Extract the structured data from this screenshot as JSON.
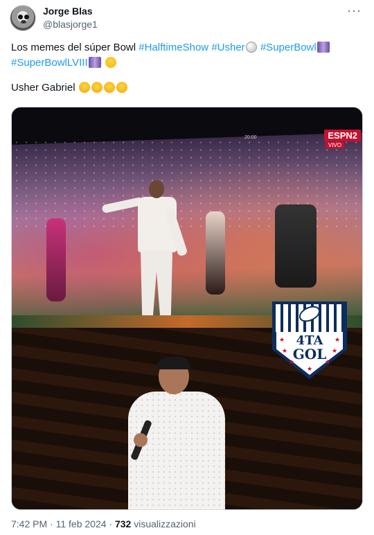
{
  "author": {
    "name": "Jorge Blas",
    "handle": "@blasjorge1",
    "avatar_icon": "seal-avatar"
  },
  "more_icon": "ellipsis-icon",
  "tweet": {
    "line1_text": "Los memes del súper Bowl ",
    "hashtags": [
      "#HalftimeShow",
      "#Usher",
      "#SuperBowl",
      "#SuperBowlLVIII"
    ],
    "line2_text": "Usher Gabriel"
  },
  "media": {
    "top_frame": {
      "network_logo": "ESPN2",
      "live_label": "VIVO",
      "timecode": "20:00"
    },
    "badge": {
      "line1": "4TA",
      "line2": "GOL",
      "line1_prefix": "&"
    }
  },
  "footer": {
    "time": "7:42 PM",
    "date": "11 feb 2024",
    "views_count": "732",
    "views_label": "visualizzazioni"
  },
  "colors": {
    "hashtag": "#1d9bf0",
    "text": "#0f1419",
    "muted": "#536471",
    "badge_navy": "#0c2d5e",
    "espn_red": "#c8102e"
  }
}
